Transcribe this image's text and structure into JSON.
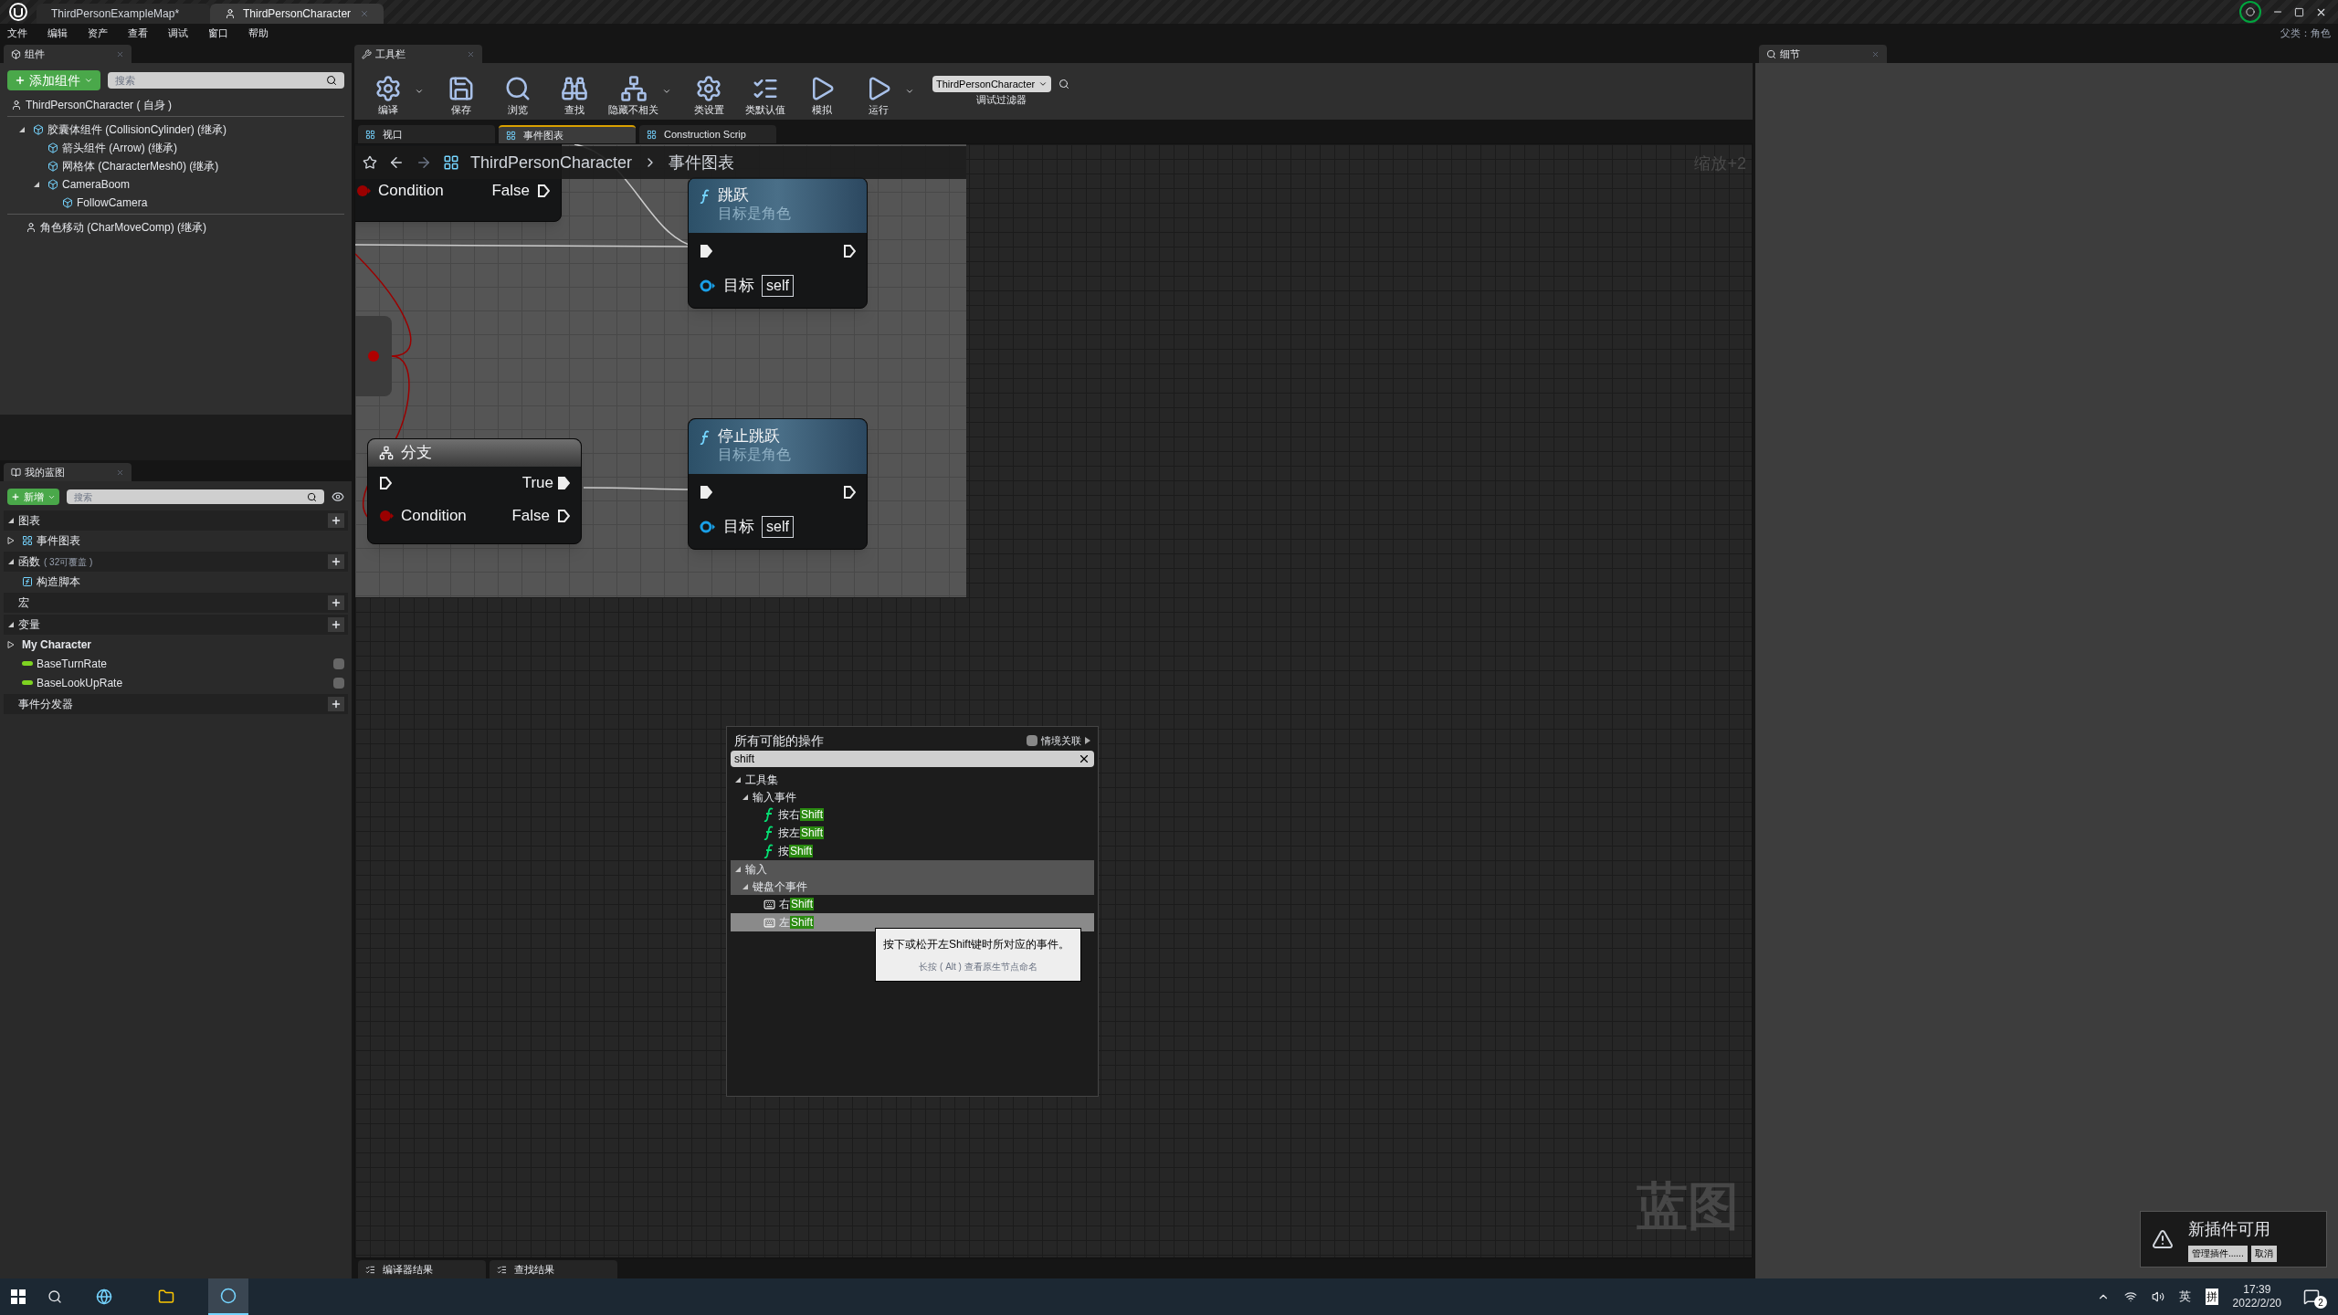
{
  "title_bar": {
    "tabs": [
      {
        "label": "ThirdPersonExampleMap*",
        "selected": false
      },
      {
        "label": "ThirdPersonCharacter",
        "selected": true
      }
    ]
  },
  "menu_bar": [
    "文件",
    "编辑",
    "资产",
    "查看",
    "调试",
    "窗口",
    "帮助"
  ],
  "parent_class": "父类：角色",
  "components_panel": {
    "tab": "组件",
    "add_button": "添加组件",
    "search": {
      "placeholder": "搜索"
    },
    "root": "ThirdPersonCharacter ( 自身 )",
    "tree": [
      {
        "label": "胶囊体组件 (CollisionCylinder) (继承)",
        "expanded": true,
        "children": [
          {
            "label": "箭头组件 (Arrow) (继承)"
          },
          {
            "label": "网格体 (CharacterMesh0) (继承)"
          },
          {
            "label": "CameraBoom",
            "expanded": true,
            "children": [
              {
                "label": "FollowCamera"
              }
            ]
          }
        ]
      }
    ],
    "movement": "角色移动 (CharMoveComp) (继承)"
  },
  "my_blueprint": {
    "tab": "我的蓝图",
    "new_button": "新增",
    "search": {
      "placeholder": "搜索"
    },
    "sections": [
      {
        "title": "图表",
        "expanded": true,
        "items": [
          {
            "label": "事件图表",
            "kind": "graph",
            "expanded": false
          }
        ]
      },
      {
        "title": "函数",
        "note": "( 32可覆盖 )",
        "expanded": true,
        "items": [
          {
            "label": "构造脚本",
            "kind": "function"
          }
        ]
      },
      {
        "title": "宏"
      },
      {
        "title": "变量",
        "expanded": true,
        "items": [
          {
            "label": "My Character",
            "kind": "category",
            "expanded": false
          },
          {
            "label": "BaseTurnRate",
            "kind": "variable"
          },
          {
            "label": "BaseLookUpRate",
            "kind": "variable"
          }
        ]
      },
      {
        "title": "事件分发器"
      }
    ]
  },
  "toolbar": {
    "tab": "工具栏",
    "buttons": [
      {
        "label": "编译",
        "kind": "compile",
        "dropdown": true
      },
      {
        "label": "保存",
        "kind": "save",
        "dropdown": false
      },
      {
        "label": "浏览",
        "kind": "browse",
        "dropdown": false
      },
      {
        "label": "查找",
        "kind": "find",
        "dropdown": false
      },
      {
        "label": "隐藏不相关",
        "kind": "hide",
        "dropdown": true
      },
      {
        "label": "类设置",
        "kind": "settings",
        "dropdown": false
      },
      {
        "label": "类默认值",
        "kind": "defaults",
        "dropdown": false
      },
      {
        "label": "模拟",
        "kind": "simulate",
        "dropdown": false
      },
      {
        "label": "运行",
        "kind": "play",
        "dropdown": true
      }
    ],
    "debug_filter": {
      "value": "ThirdPersonCharacter",
      "label": "调试过滤器"
    }
  },
  "doc_tabs": [
    {
      "label": "视口",
      "selected": false
    },
    {
      "label": "事件图表",
      "selected": true
    },
    {
      "label": "Construction Scrip",
      "selected": false
    }
  ],
  "breadcrumb": [
    "ThirdPersonCharacter",
    "事件图表"
  ],
  "zoom": "缩放+2",
  "graph": {
    "nodes": [
      {
        "kind": "branch_cut",
        "condition": "Condition",
        "false_label": "False"
      },
      {
        "kind": "function",
        "title": "跳跃",
        "subtitle": "目标是角色",
        "target_label": "目标",
        "target_value": "self"
      },
      {
        "kind": "branch",
        "title": "分支",
        "true_label": "True",
        "condition": "Condition",
        "false_label": "False"
      },
      {
        "kind": "function",
        "title": "停止跳跃",
        "subtitle": "目标是角色",
        "target_label": "目标",
        "target_value": "self"
      }
    ],
    "label": "蓝图"
  },
  "action_menu": {
    "title": "所有可能的操作",
    "context_toggle": {
      "label": "情境关联",
      "checked": false
    },
    "search": {
      "value": "shift"
    },
    "tree": [
      {
        "label": "工具集",
        "expanded": true,
        "highlighted": false,
        "children": [
          {
            "label": "输入事件",
            "expanded": true,
            "highlighted": false,
            "children": [
              {
                "text": "按右",
                "match": "Shift",
                "kind": "function",
                "selected": false
              },
              {
                "text": "按左",
                "match": "Shift",
                "kind": "function",
                "selected": false
              },
              {
                "text": "按",
                "match": "Shift",
                "kind": "function",
                "selected": false
              }
            ]
          }
        ]
      },
      {
        "label": "输入",
        "expanded": true,
        "highlighted": true,
        "children": [
          {
            "label": "键盘个事件",
            "expanded": true,
            "highlighted": true,
            "children": [
              {
                "text": "右",
                "match": "Shift",
                "kind": "key",
                "selected": false
              },
              {
                "text": "左",
                "match": "Shift",
                "kind": "key",
                "selected": true
              }
            ]
          }
        ]
      }
    ],
    "tooltip": {
      "text": "按下或松开左Shift键时所对应的事件。",
      "hint": "长按 ( Alt ) 查看原生节点命名"
    }
  },
  "bottom_tabs": [
    "编译器结果",
    "查找结果"
  ],
  "details": {
    "tab": "细节"
  },
  "notification": {
    "title": "新插件可用",
    "buttons": [
      "管理插件......",
      "取消"
    ]
  },
  "taskbar": {
    "apps": [
      {
        "kind": "edge",
        "selected": false
      },
      {
        "kind": "explorer",
        "selected": false
      },
      {
        "kind": "unreal",
        "selected": true
      }
    ],
    "input": "英",
    "ime": "拼",
    "time": "17:39",
    "date": "2022/2/20",
    "notifications": "2"
  }
}
